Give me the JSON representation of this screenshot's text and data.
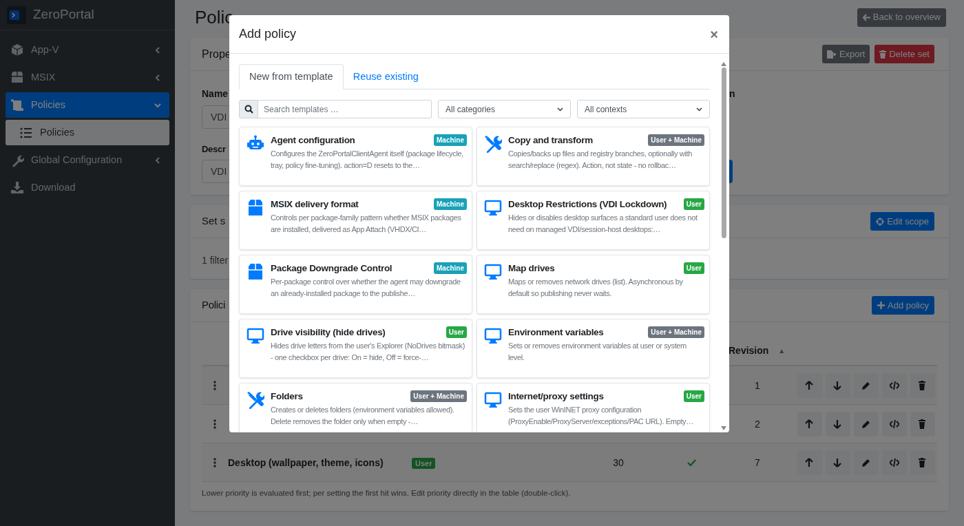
{
  "sidebar": {
    "brand": "ZeroPortal",
    "items": [
      {
        "label": "App-V",
        "kind": "group",
        "expanded": false,
        "selected": false
      },
      {
        "label": "MSIX",
        "kind": "group",
        "expanded": false,
        "selected": false
      },
      {
        "label": "Policies",
        "kind": "group",
        "expanded": true,
        "selected": true,
        "children": [
          {
            "label": "Policies",
            "selected": true
          }
        ]
      },
      {
        "label": "Global Configuration",
        "kind": "group",
        "expanded": false,
        "selected": false
      },
      {
        "label": "Download",
        "kind": "link",
        "selected": false
      }
    ]
  },
  "page": {
    "title": "Polic",
    "back_button": "Back to overview"
  },
  "properties_card": {
    "header": "Prope",
    "buttons": [
      {
        "label": "Export",
        "kind": "export"
      },
      {
        "label": "Delete set",
        "kind": "delete"
      }
    ],
    "name_label": "Name",
    "name_value": "VDI",
    "description_label": "Descr",
    "description_value": "VDI",
    "column_2_label": "n"
  },
  "scope_card": {
    "header": "Set s",
    "button": "Edit scope",
    "summary": "1 filter"
  },
  "policies_card": {
    "header": "Polici",
    "button": "Add policy",
    "columns": [
      {
        "label": "Revision",
        "sort_indicator": "▲"
      }
    ],
    "rows": [
      {
        "revision": "1"
      },
      {
        "revision": "2"
      },
      {
        "name": "Desktop (wallpaper, theme, icons)",
        "badge": {
          "text": "User",
          "color": "#145323"
        },
        "priority": "30",
        "enabled": true,
        "revision": "7"
      }
    ],
    "footnote": "Lower priority is evaluated first; per setting the first hit wins. Edit priority directly in the table (double-click)."
  },
  "modal": {
    "title": "Add policy",
    "close": "×",
    "tabs": [
      {
        "label": "New from template",
        "selected": true
      },
      {
        "label": "Reuse existing",
        "selected": false
      }
    ],
    "search_placeholder": "Search templates …",
    "filters": [
      "All categories",
      "All contexts"
    ],
    "templates": [
      {
        "title": "Agent configuration",
        "kind": "robot",
        "badge": {
          "text": "Machine",
          "color": "#17a2b8"
        },
        "description": "Configures the ZeroPortalClientAgent itself (package lifecycle, tray, policy fine-tuning). action=D resets to the…"
      },
      {
        "title": "Copy and transform",
        "kind": "tools",
        "badge": {
          "text": "User + Machine",
          "color": "#6c757d"
        },
        "description": "Copies/backs up files and registry branches, optionally with search/replace (regex). Action, not state - no rollbac…"
      },
      {
        "title": "MSIX delivery format",
        "kind": "box",
        "badge": {
          "text": "Machine",
          "color": "#17a2b8"
        },
        "description": "Controls per package-family pattern whether MSIX packages are installed, delivered as App Attach (VHDX/CI…"
      },
      {
        "title": "Desktop Restrictions (VDI Lockdown)",
        "kind": "desktop",
        "badge": {
          "text": "User",
          "color": "#28a745"
        },
        "description": "Hides or disables desktop surfaces a standard user does not need on managed VDI/session-host desktops:…"
      },
      {
        "title": "Package Downgrade Control",
        "kind": "box",
        "badge": {
          "text": "Machine",
          "color": "#17a2b8"
        },
        "description": "Per-package control over whether the agent may downgrade an already-installed package to the publishe…"
      },
      {
        "title": "Map drives",
        "kind": "desktop",
        "badge": {
          "text": "User",
          "color": "#28a745"
        },
        "description": "Maps or removes network drives (list). Asynchronous by default so publishing never waits."
      },
      {
        "title": "Drive visibility (hide drives)",
        "kind": "desktop",
        "badge": {
          "text": "User",
          "color": "#28a745"
        },
        "description": "Hides drive letters from the user's Explorer (NoDrives bitmask) - one checkbox per drive: On = hide, Off = force-…"
      },
      {
        "title": "Environment variables",
        "kind": "desktop",
        "badge": {
          "text": "User + Machine",
          "color": "#6c757d"
        },
        "description": "Sets or removes environment variables at user or system level."
      },
      {
        "title": "Folders",
        "kind": "tools",
        "badge": {
          "text": "User + Machine",
          "color": "#6c757d"
        },
        "description": "Creates or deletes folders (environment variables allowed). Delete removes the folder only when empty -…"
      },
      {
        "title": "Internet/proxy settings",
        "kind": "desktop",
        "badge": {
          "text": "User",
          "color": "#28a745"
        },
        "description": "Sets the user WinINET proxy configuration (ProxyEnable/ProxyServer/exceptions/PAC URL). Empty…"
      }
    ]
  }
}
